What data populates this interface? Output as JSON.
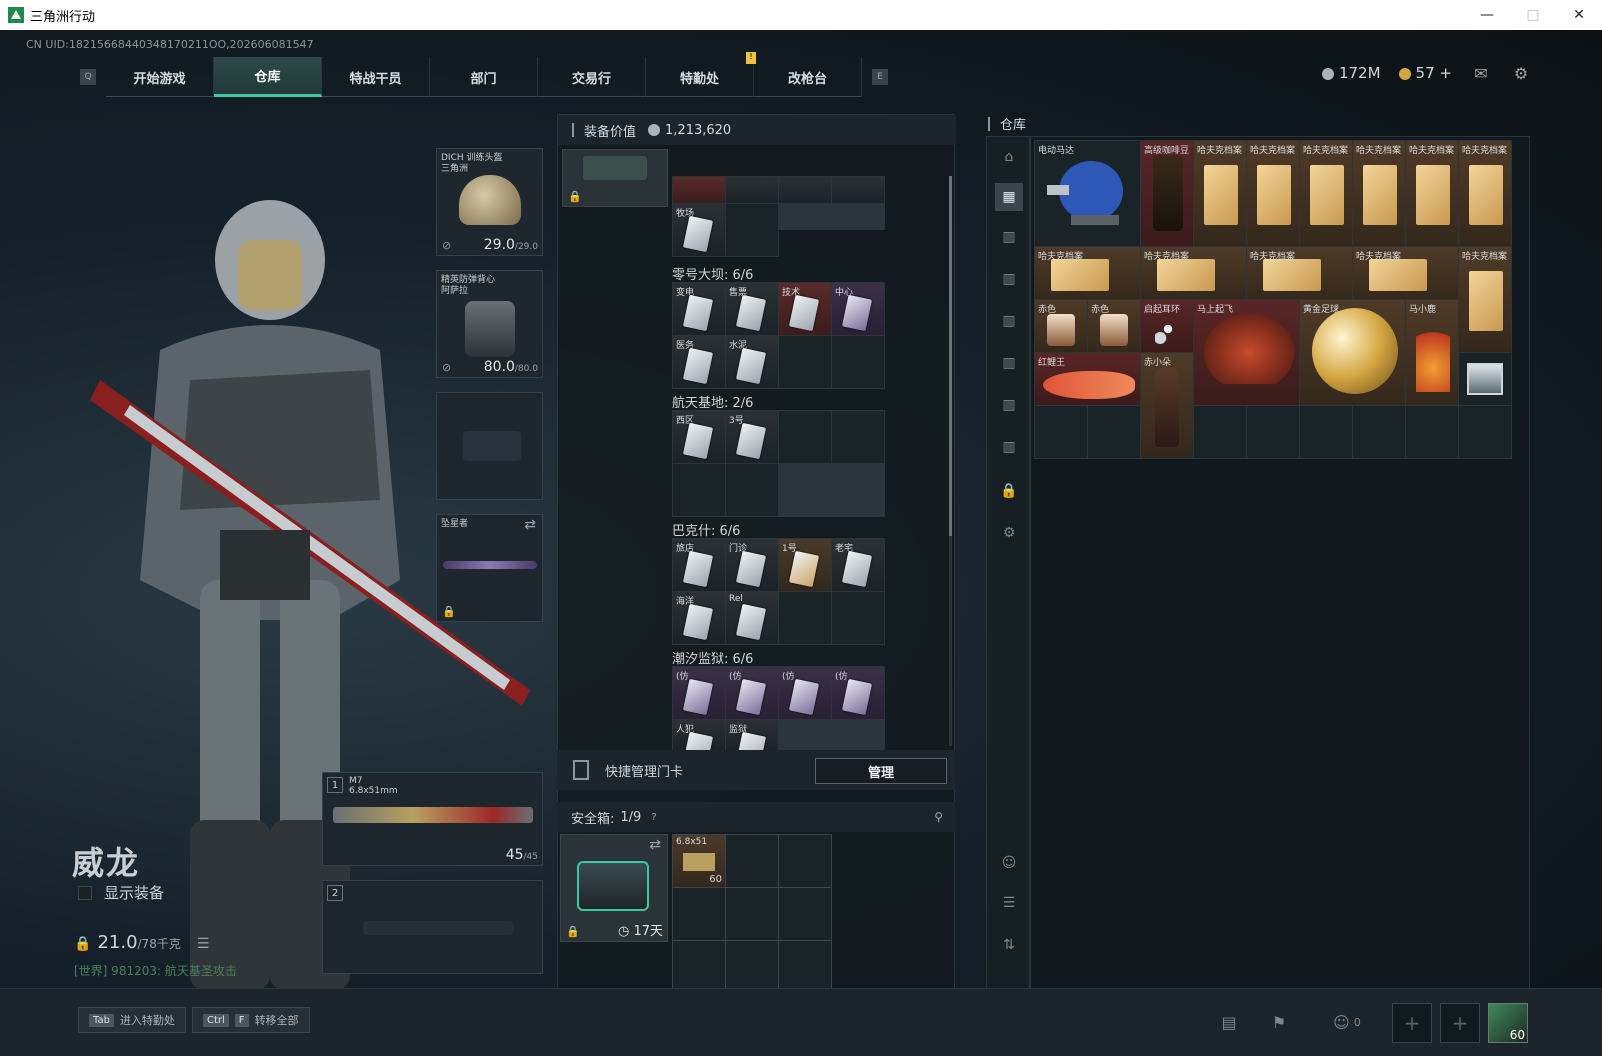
{
  "window": {
    "title": "三角洲行动"
  },
  "uid": "CN UID:18215668440348170211OO,202606081547",
  "nav": {
    "left_key": "Q",
    "right_key": "E",
    "tabs": [
      "开始游戏",
      "仓库",
      "特战干员",
      "部门",
      "交易行",
      "特勤处",
      "改枪台"
    ],
    "active_index": 1
  },
  "currency": {
    "coins": "172M",
    "tickets": "57",
    "add": "+"
  },
  "header_icons": [
    "mail-icon",
    "gear-icon"
  ],
  "character": {
    "name": "威龙",
    "show_equipment": "显示装备",
    "weight": "21.0",
    "weight_max": "/78千克"
  },
  "chat": "[世界] 981203: 航天基圣攻击",
  "equipment": {
    "helmet": {
      "label": "DICH 训练头盔",
      "sublabel": "三角洲",
      "value": "29.0",
      "max": "/29.0"
    },
    "armor": {
      "label": "精英防弹背心",
      "sublabel": "阿萨拉",
      "value": "80.0",
      "max": "/80.0"
    },
    "melee": {
      "label": "坠星者"
    },
    "primary": {
      "slot": "1",
      "name": "M7",
      "ammo_type": "6.8x51mm",
      "ammo": "45",
      "ammo_max": "/45"
    },
    "secondary": {
      "slot": "2"
    }
  },
  "middle": {
    "header_label": "装备价值",
    "header_value": "1,213,620",
    "section_top_card": "牧场",
    "sections": [
      {
        "title": "零号大坝: 6/6",
        "cards": [
          "变电",
          "售票",
          "技术",
          "中心",
          "医务",
          "水泥"
        ]
      },
      {
        "title": "航天基地: 2/6",
        "cards": [
          "西区",
          "3号"
        ]
      },
      {
        "title": "巴克什: 6/6",
        "cards": [
          "旅店",
          "门诊",
          "1号",
          "老宅",
          "海洋",
          "Rel"
        ]
      },
      {
        "title": "潮汐监狱: 6/6",
        "cards": [
          "(仿",
          "(仿",
          "(仿",
          "(仿",
          "人犯",
          "监狱"
        ]
      }
    ],
    "quick_label": "快捷管理门卡",
    "manage": "管理",
    "safe_label": "安全箱:",
    "safe_count": "1/9",
    "safe_help": "?",
    "safe_days": "17天",
    "ammo_item": {
      "label": "6.8x51",
      "count": "60"
    }
  },
  "warehouse": {
    "title": "仓库",
    "items": {
      "motor": "电动马达",
      "coffee": "高级咖啡豆",
      "file": "哈夫克档案",
      "jar": "赤色",
      "earring": "启起耳环",
      "horse": "马上起飞",
      "ball": "黄金足球",
      "parrot": "马小鹿",
      "fish": "红鲤王",
      "figure": "赤小朵"
    }
  },
  "bottom": {
    "hint1_key": "Tab",
    "hint1": "进入特勤处",
    "hint2_key1": "Ctrl",
    "hint2_key2": "F",
    "hint2": "转移全部",
    "squad_count": "0",
    "avatar_level": "60"
  }
}
